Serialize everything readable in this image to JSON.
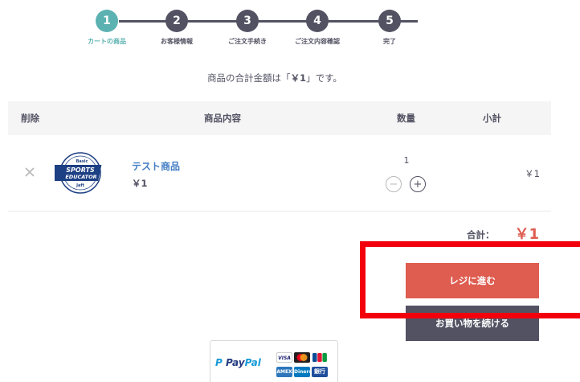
{
  "steps": [
    {
      "number": "1",
      "label": "カートの商品"
    },
    {
      "number": "2",
      "label": "お客様情報"
    },
    {
      "number": "3",
      "label": "ご注文手続き"
    },
    {
      "number": "4",
      "label": "ご注文内容確認"
    },
    {
      "number": "5",
      "label": "完了"
    }
  ],
  "active_step": 1,
  "message": {
    "prefix": "商品の合計金額は「",
    "amount": "￥1",
    "suffix": "」です。"
  },
  "table": {
    "headers": {
      "delete": "削除",
      "content": "商品内容",
      "quantity": "数量",
      "subtotal": "小計"
    },
    "rows": [
      {
        "name": "テスト商品",
        "price": "￥1",
        "quantity": "1",
        "subtotal": "￥1",
        "thumbnail_text": [
          "Basic",
          "SPORTS",
          "EDUCATOR",
          "Jaft"
        ]
      }
    ]
  },
  "qty_controls": {
    "minus": "−",
    "plus": "+"
  },
  "total": {
    "label": "合計：",
    "value": "￥1"
  },
  "buttons": {
    "checkout": "レジに進む",
    "continue": "お買い物を続ける"
  },
  "payment": {
    "paypal": {
      "pay": "Pay",
      "pal": "Pal"
    },
    "cards": {
      "visa": "VISA",
      "amex": "AMEX",
      "diners": "Diners",
      "bank": "銀行"
    }
  },
  "colors": {
    "accent": "#5cb1b1",
    "dark": "#525263",
    "checkout": "#de5d50",
    "link": "#437ec4",
    "highlight": "#f2000b"
  },
  "icons": {
    "remove": "close-icon",
    "qty_minus": "minus-circle-icon",
    "qty_plus": "plus-circle-icon",
    "paypal": "paypal-logo",
    "cards": [
      "visa-card-icon",
      "mastercard-icon",
      "jcb-card-icon",
      "amex-card-icon",
      "diners-card-icon",
      "bank-transfer-icon"
    ]
  }
}
